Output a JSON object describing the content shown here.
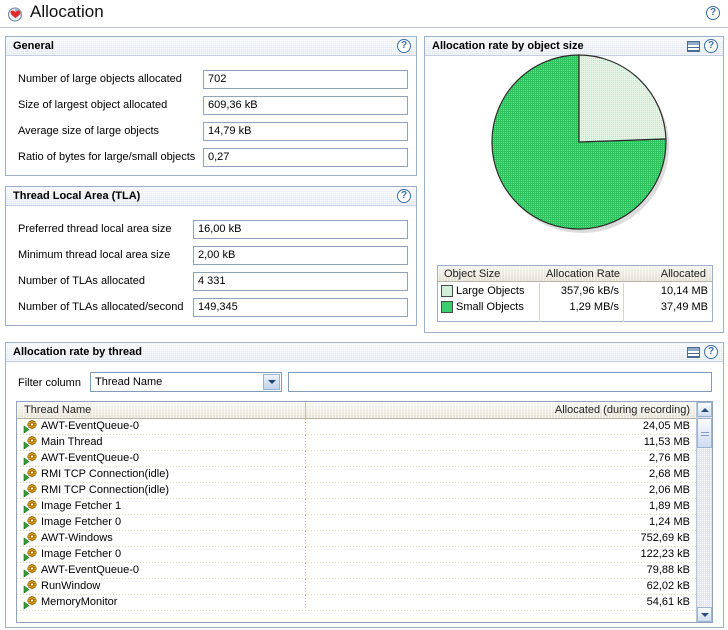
{
  "page": {
    "title": "Allocation",
    "title_icon": "pie-chart-icon",
    "help_icon": "?"
  },
  "general": {
    "header": "General",
    "help_icon": "?",
    "fields": [
      {
        "label": "Number of large objects allocated",
        "value": "702"
      },
      {
        "label": "Size of largest object allocated",
        "value": "609,36 kB"
      },
      {
        "label": "Average size of large objects",
        "value": "14,79 kB"
      },
      {
        "label": "Ratio of bytes for large/small objects",
        "value": "0,27"
      }
    ]
  },
  "tla": {
    "header": "Thread Local Area (TLA)",
    "help_icon": "?",
    "fields": [
      {
        "label": "Preferred thread local area size",
        "value": "16,00 kB"
      },
      {
        "label": "Minimum thread local area size",
        "value": "2,00 kB"
      },
      {
        "label": "Number of TLAs allocated",
        "value": "4 331"
      },
      {
        "label": "Number of TLAs allocated/second",
        "value": "149,345"
      }
    ]
  },
  "object_size": {
    "header": "Allocation rate by object size",
    "grid_icon": "table-icon",
    "help_icon": "?",
    "legend_columns": [
      "Object Size",
      "Allocation Rate",
      "Allocated"
    ],
    "legend_rows": [
      {
        "name": "Large Objects",
        "rate": "357,96 kB/s",
        "allocated": "10,14 MB",
        "color": "#dff3e2"
      },
      {
        "name": "Small Objects",
        "rate": "1,29 MB/s",
        "allocated": "37,49 MB",
        "color": "#2cc35b"
      }
    ]
  },
  "chart_data": {
    "type": "pie",
    "title": "Allocation rate by object size",
    "labels": [
      "Large Objects",
      "Small Objects"
    ],
    "values": [
      10.14,
      37.49
    ],
    "value_unit": "MB",
    "percent": [
      21.3,
      78.7
    ],
    "rates": [
      "357,96 kB/s",
      "1,29 MB/s"
    ],
    "colors": [
      "#dff3e2",
      "#2cc35b"
    ],
    "start_angle_deg": 0,
    "direction": "clockwise",
    "legend_position": "below",
    "grid": false
  },
  "by_thread": {
    "header": "Allocation rate by thread",
    "grid_icon": "table-icon",
    "help_icon": "?",
    "filter_label": "Filter column",
    "filter_selected": "Thread Name",
    "filter_options": [
      "Thread Name",
      "Allocated (during recording)"
    ],
    "filter_text_value": "",
    "filter_text_placeholder": "",
    "columns": [
      "Thread Name",
      "Allocated (during recording)"
    ],
    "rows": [
      {
        "name": "AWT-EventQueue-0",
        "allocated": "24,05 MB"
      },
      {
        "name": "Main Thread",
        "allocated": "11,53 MB"
      },
      {
        "name": "AWT-EventQueue-0",
        "allocated": "2,76 MB"
      },
      {
        "name": "RMI TCP Connection(idle)",
        "allocated": "2,68 MB"
      },
      {
        "name": "RMI TCP Connection(idle)",
        "allocated": "2,06 MB"
      },
      {
        "name": "Image Fetcher 1",
        "allocated": "1,89 MB"
      },
      {
        "name": "Image Fetcher 0",
        "allocated": "1,24 MB"
      },
      {
        "name": "AWT-Windows",
        "allocated": "752,69 kB"
      },
      {
        "name": "Image Fetcher 0",
        "allocated": "122,23 kB"
      },
      {
        "name": "AWT-EventQueue-0",
        "allocated": "79,88 kB"
      },
      {
        "name": "RunWindow",
        "allocated": "62,02 kB"
      },
      {
        "name": "MemoryMonitor",
        "allocated": "54,61 kB"
      }
    ]
  },
  "colors": {
    "accent": "#2cc35b",
    "accent_light": "#dff3e2",
    "panel_border": "#9eb0c6",
    "header_text": "#000000"
  }
}
